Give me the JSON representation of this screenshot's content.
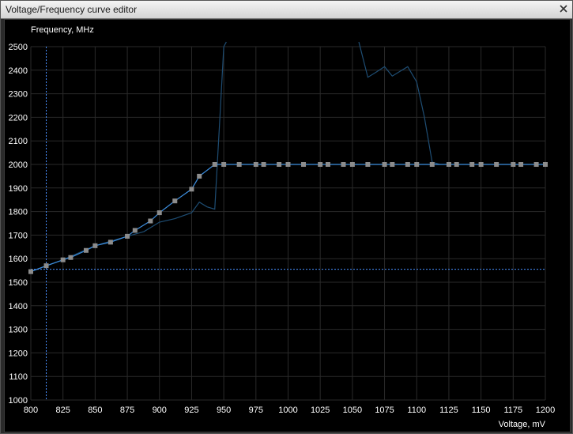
{
  "window": {
    "title": "Voltage/Frequency curve editor"
  },
  "icons": {
    "close": "close-icon"
  },
  "colors": {
    "background": "#000000",
    "grid": "#2a2a2a",
    "curve": "#3d8fe0",
    "points": "#8c8c8c",
    "cursor": "#4a90ff",
    "shadow_curve": "#1e4d73",
    "text": "#ffffff"
  },
  "chart_data": {
    "type": "line",
    "ylabel": "Frequency, MHz",
    "xlabel": "Voltage, mV",
    "xlim": [
      800,
      1200
    ],
    "ylim": [
      1000,
      2500
    ],
    "xticks": [
      800,
      825,
      850,
      875,
      900,
      925,
      950,
      975,
      1000,
      1025,
      1050,
      1075,
      1100,
      1125,
      1150,
      1175,
      1200
    ],
    "yticks": [
      1000,
      1100,
      1200,
      1300,
      1400,
      1500,
      1600,
      1700,
      1800,
      1900,
      2000,
      2100,
      2200,
      2300,
      2400,
      2500
    ],
    "grid": true,
    "cursor": {
      "x": 812,
      "y": 1555
    },
    "series": [
      {
        "points": [
          [
            800,
            1545
          ],
          [
            812,
            1570
          ],
          [
            825,
            1595
          ],
          [
            831,
            1605
          ],
          [
            843,
            1635
          ],
          [
            850,
            1655
          ],
          [
            862,
            1670
          ],
          [
            875,
            1695
          ],
          [
            881,
            1720
          ],
          [
            893,
            1760
          ],
          [
            900,
            1795
          ],
          [
            912,
            1845
          ],
          [
            925,
            1895
          ],
          [
            931,
            1950
          ],
          [
            943,
            2000
          ],
          [
            950,
            2000
          ],
          [
            962,
            2000
          ],
          [
            975,
            2000
          ],
          [
            981,
            2000
          ],
          [
            993,
            2000
          ],
          [
            1000,
            2000
          ],
          [
            1012,
            2000
          ],
          [
            1025,
            2000
          ],
          [
            1031,
            2000
          ],
          [
            1043,
            2000
          ],
          [
            1050,
            2000
          ],
          [
            1062,
            2000
          ],
          [
            1075,
            2000
          ],
          [
            1081,
            2000
          ],
          [
            1093,
            2000
          ],
          [
            1100,
            2000
          ],
          [
            1112,
            2000
          ],
          [
            1125,
            2000
          ],
          [
            1131,
            2000
          ],
          [
            1143,
            2000
          ],
          [
            1150,
            2000
          ],
          [
            1162,
            2000
          ],
          [
            1175,
            2000
          ],
          [
            1181,
            2000
          ],
          [
            1193,
            2000
          ],
          [
            1200,
            2000
          ]
        ]
      },
      {
        "points": [
          [
            800,
            1545
          ],
          [
            825,
            1595
          ],
          [
            850,
            1655
          ],
          [
            875,
            1695
          ],
          [
            888,
            1715
          ],
          [
            900,
            1755
          ],
          [
            912,
            1770
          ],
          [
            925,
            1795
          ],
          [
            931,
            1840
          ],
          [
            937,
            1820
          ],
          [
            943,
            1810
          ],
          [
            947,
            2200
          ],
          [
            950,
            2500
          ],
          [
            952,
            2520
          ]
        ]
      },
      {
        "points": [
          [
            1055,
            2520
          ],
          [
            1062,
            2370
          ],
          [
            1068,
            2390
          ],
          [
            1075,
            2415
          ],
          [
            1081,
            2375
          ],
          [
            1087,
            2395
          ],
          [
            1093,
            2415
          ],
          [
            1100,
            2350
          ],
          [
            1106,
            2200
          ],
          [
            1112,
            2010
          ],
          [
            1118,
            2000
          ]
        ]
      }
    ]
  }
}
